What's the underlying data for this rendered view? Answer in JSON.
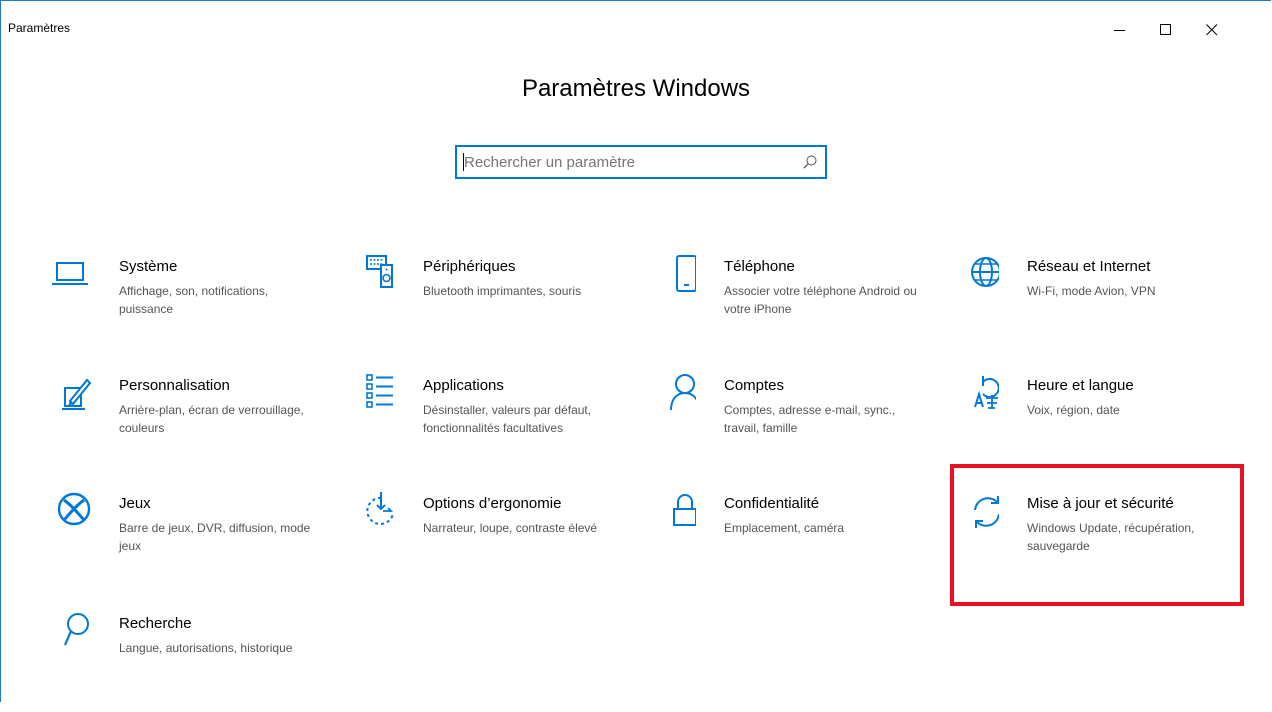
{
  "window": {
    "title": "Paramètres",
    "controls": [
      "minimize",
      "maximize",
      "close"
    ],
    "accent_color": "#0078d7"
  },
  "page": {
    "title": "Paramètres Windows"
  },
  "search": {
    "placeholder": "Rechercher un paramètre",
    "value": "",
    "icon": "search-icon"
  },
  "categories": [
    {
      "id": "systeme",
      "icon": "laptop-icon",
      "label": "Système",
      "description": "Affichage, son, notifications, puissance"
    },
    {
      "id": "peripheriques",
      "icon": "keyboard-speaker-icon",
      "label": "Périphériques",
      "description": "Bluetooth imprimantes, souris"
    },
    {
      "id": "telephone",
      "icon": "phone-icon",
      "label": "Téléphone",
      "description": "Associer votre téléphone Android ou votre iPhone"
    },
    {
      "id": "reseau",
      "icon": "globe-icon",
      "label": "Réseau et Internet",
      "description": "Wi-Fi, mode Avion, VPN"
    },
    {
      "id": "personnalisation",
      "icon": "paint-pen-icon",
      "label": "Personnalisation",
      "description": "Arrière-plan, écran de verrouillage, couleurs"
    },
    {
      "id": "applications",
      "icon": "app-list-icon",
      "label": "Applications",
      "description": "Désinstaller, valeurs par défaut, fonctionnalités facultatives"
    },
    {
      "id": "comptes",
      "icon": "person-icon",
      "label": "Comptes",
      "description": "Comptes, adresse e-mail, sync., travail, famille"
    },
    {
      "id": "heure",
      "icon": "time-language-icon",
      "label": "Heure et langue",
      "description": "Voix, région, date"
    },
    {
      "id": "jeux",
      "icon": "xbox-icon",
      "label": "Jeux",
      "description": "Barre de jeux, DVR, diffusion, mode jeux"
    },
    {
      "id": "ergonomie",
      "icon": "ease-of-access-icon",
      "label": "Options d’ergonomie",
      "description": "Narrateur, loupe, contraste élevé"
    },
    {
      "id": "confidentialite",
      "icon": "lock-icon",
      "label": "Confidentialité",
      "description": "Emplacement, caméra"
    },
    {
      "id": "miseajour",
      "icon": "sync-icon",
      "label": "Mise à jour et sécurité",
      "description": "Windows Update, récupération, sauvegarde",
      "highlighted": true
    },
    {
      "id": "recherche",
      "icon": "search-icon",
      "label": "Recherche",
      "description": "Langue, autorisations, historique"
    }
  ],
  "highlight_color": "#e81123"
}
